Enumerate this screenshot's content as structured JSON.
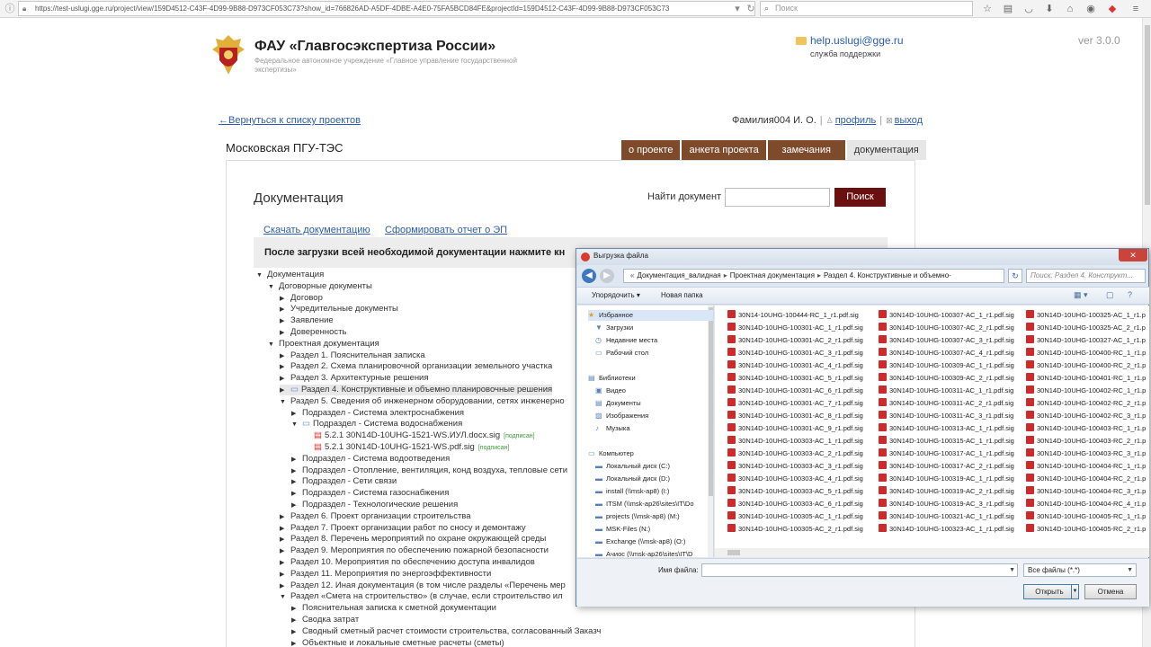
{
  "browser": {
    "url": "https://test-uslugi.gge.ru/project/view/159D4512-C43F-4D99-9B88-D973CF053C73?show_id=766826AD-A5DF-4DBE-A4E0-75FA5BCD84FE&projectId=159D4512-C43F-4D99-9B88-D973CF053C73",
    "search_placeholder": "Поиск"
  },
  "header": {
    "org_title": "ФАУ «Главгосэкспертиза России»",
    "org_subtitle": "Федеральное автономное учреждение «Главное управление государственной экспертизы»",
    "help_email": "help.uslugi@gge.ru",
    "help_caption": "служба поддержки",
    "version": "ver 3.0.0"
  },
  "nav": {
    "back_link": "Вернуться к списку проектов",
    "user_name": "Фамилия004 И. О.",
    "profile": "профиль",
    "logout": "выход"
  },
  "project": {
    "title": "Московская ПГУ-ТЭС",
    "tabs": [
      {
        "label": "о проекте"
      },
      {
        "label": "анкета проекта"
      },
      {
        "label": "замечания"
      },
      {
        "label": "документация"
      }
    ]
  },
  "docs": {
    "heading": "Документация",
    "find_label": "Найти документ",
    "find_button": "Поиск",
    "download_link": "Скачать документацию",
    "report_link": "Сформировать отчет о ЭП",
    "notice": "После загрузки всей необходимой документации нажмите кн"
  },
  "tree": [
    {
      "label": "Документация",
      "tw": "▼"
    },
    {
      "label": "Договорные документы",
      "tw": "▼"
    },
    {
      "label": "Договор",
      "tw": "▶"
    },
    {
      "label": "Учредительные документы",
      "tw": "▶"
    },
    {
      "label": "Заявление",
      "tw": "▶"
    },
    {
      "label": "Доверенность",
      "tw": "▶"
    },
    {
      "label": "Проектная документация",
      "tw": "▼"
    },
    {
      "label": "Раздел 1. Пояснительная записка",
      "tw": "▶"
    },
    {
      "label": "Раздел 2. Схема планировочной организации земельного участка",
      "tw": "▶"
    },
    {
      "label": "Раздел 3. Архитектурные решения",
      "tw": "▶"
    },
    {
      "label": "Раздел 4. Конструктивные и объемно планировочные решения",
      "tw": "▶"
    },
    {
      "label": "Раздел 5. Сведения об инженерном оборудовании, сетях инженерно",
      "tw": "▼"
    },
    {
      "label": "Подраздел - Система электроснабжения",
      "tw": "▶"
    },
    {
      "label": "Подраздел - Система водоснабжения",
      "tw": "▼"
    },
    {
      "label": "5.2.1 30N14D-10UHG-1521-WS.ИУЛ.docx.sig",
      "tw": "",
      "badge": "[подписан]"
    },
    {
      "label": "5.2.1 30N14D-10UHG-1521-WS.pdf.sig",
      "tw": "",
      "badge": "[подписан]"
    },
    {
      "label": "Подраздел - Система водоотведения",
      "tw": "▶"
    },
    {
      "label": "Подраздел - Отопление, вентиляция, конд воздуха, тепловые сети",
      "tw": "▶"
    },
    {
      "label": "Подраздел - Сети связи",
      "tw": "▶"
    },
    {
      "label": "Подраздел - Система газоснабжения",
      "tw": "▶"
    },
    {
      "label": "Подраздел - Технологические решения",
      "tw": "▶"
    },
    {
      "label": "Раздел 6. Проект организации строительства",
      "tw": "▶"
    },
    {
      "label": "Раздел 7. Проект организации работ по сносу и демонтажу",
      "tw": "▶"
    },
    {
      "label": "Раздел 8. Перечень мероприятий по охране окружающей среды",
      "tw": "▶"
    },
    {
      "label": "Раздел 9. Мероприятия по обеспечению пожарной безопасности",
      "tw": "▶"
    },
    {
      "label": "Раздел 10. Мероприятия по обеспечению доступа инвалидов",
      "tw": "▶"
    },
    {
      "label": "Раздел 11. Мероприятия по энергоэффективности",
      "tw": "▶"
    },
    {
      "label": "Раздел 12. Иная документация (в том числе разделы «Перечень мер",
      "tw": "▶"
    },
    {
      "label": "Раздел «Смета на строительство» (в случае, если строительство ил",
      "tw": "▼"
    },
    {
      "label": "Пояснительная записка к сметной документации",
      "tw": "▶"
    },
    {
      "label": "Сводка затрат",
      "tw": "▶"
    },
    {
      "label": "Сводный сметный расчет стоимости строительства, согласованный Заказч",
      "tw": "▶"
    },
    {
      "label": "Объектные и локальные сметные расчеты (сметы)",
      "tw": "▶"
    }
  ],
  "dialog": {
    "title": "Выгрузка файла",
    "breadcrumb": [
      "Документация_валидная",
      "Проектная документация",
      "Раздел 4. Конструктивные и объемно-"
    ],
    "search_placeholder": "Поиск: Раздел 4. Конструкт...",
    "organize": "Упорядочить ▾",
    "new_folder": "Новая папка",
    "nav": [
      {
        "label": "Избранное",
        "icon": "★"
      },
      {
        "label": "Загрузки",
        "icon": "▼"
      },
      {
        "label": "Недавние места",
        "icon": "◷"
      },
      {
        "label": "Рабочий стол",
        "icon": "▭"
      },
      {
        "label": "Библиотеки",
        "icon": "▤"
      },
      {
        "label": "Видео",
        "icon": "▣"
      },
      {
        "label": "Документы",
        "icon": "▤"
      },
      {
        "label": "Изображения",
        "icon": "▨"
      },
      {
        "label": "Музыка",
        "icon": "♪"
      },
      {
        "label": "Компьютер",
        "icon": "▭"
      },
      {
        "label": "Локальный диск (C:)",
        "icon": "▬"
      },
      {
        "label": "Локальный диск (D:)",
        "icon": "▬"
      },
      {
        "label": "install (\\\\msk-ap8) (I:)",
        "icon": "▬"
      },
      {
        "label": "ITSM (\\\\msk-ap26\\sites\\IT\\Do",
        "icon": "▬"
      },
      {
        "label": "projects (\\\\msk-ap8) (M:)",
        "icon": "▬"
      },
      {
        "label": "MSK-Files (N:)",
        "icon": "▬"
      },
      {
        "label": "Exchange (\\\\msk-ap8) (O:)",
        "icon": "▬"
      },
      {
        "label": "Ачиос (\\\\msk-ap26\\sites\\IT\\D",
        "icon": "▬"
      }
    ],
    "files_col1": [
      "30N14-10UHG-100444-RC_1_r1.pdf.sig",
      "30N14D-10UHG-100301-AC_1_r1.pdf.sig",
      "30N14D-10UHG-100301-AC_2_r1.pdf.sig",
      "30N14D-10UHG-100301-AC_3_r1.pdf.sig",
      "30N14D-10UHG-100301-AC_4_r1.pdf.sig",
      "30N14D-10UHG-100301-AC_5_r1.pdf.sig",
      "30N14D-10UHG-100301-AC_6_r1.pdf.sig",
      "30N14D-10UHG-100301-AC_7_r1.pdf.sig",
      "30N14D-10UHG-100301-AC_8_r1.pdf.sig",
      "30N14D-10UHG-100301-AC_9_r1.pdf.sig",
      "30N14D-10UHG-100303-AC_1_r1.pdf.sig",
      "30N14D-10UHG-100303-AC_2_r1.pdf.sig",
      "30N14D-10UHG-100303-AC_3_r1.pdf.sig",
      "30N14D-10UHG-100303-AC_4_r1.pdf.sig",
      "30N14D-10UHG-100303-AC_5_r1.pdf.sig",
      "30N14D-10UHG-100303-AC_6_r1.pdf.sig",
      "30N14D-10UHG-100305-AC_1_r1.pdf.sig",
      "30N14D-10UHG-100305-AC_2_r1.pdf.sig"
    ],
    "files_col2": [
      "30N14D-10UHG-100307-AC_1_r1.pdf.sig",
      "30N14D-10UHG-100307-AC_2_r1.pdf.sig",
      "30N14D-10UHG-100307-AC_3_r1.pdf.sig",
      "30N14D-10UHG-100307-AC_4_r1.pdf.sig",
      "30N14D-10UHG-100309-AC_1_r1.pdf.sig",
      "30N14D-10UHG-100309-AC_2_r1.pdf.sig",
      "30N14D-10UHG-100311-AC_1_r1.pdf.sig",
      "30N14D-10UHG-100311-AC_2_r1.pdf.sig",
      "30N14D-10UHG-100311-AC_3_r1.pdf.sig",
      "30N14D-10UHG-100313-AC_1_r1.pdf.sig",
      "30N14D-10UHG-100315-AC_1_r1.pdf.sig",
      "30N14D-10UHG-100317-AC_1_r1.pdf.sig",
      "30N14D-10UHG-100317-AC_2_r1.pdf.sig",
      "30N14D-10UHG-100319-AC_1_r1.pdf.sig",
      "30N14D-10UHG-100319-AC_2_r1.pdf.sig",
      "30N14D-10UHG-100319-AC_3_r1.pdf.sig",
      "30N14D-10UHG-100321-AC_1_r1.pdf.sig",
      "30N14D-10UHG-100323-AC_1_r1.pdf.sig"
    ],
    "files_col3": [
      "30N14D-10UHG-100325-AC_1_r1.p",
      "30N14D-10UHG-100325-AC_2_r1.p",
      "30N14D-10UHG-100327-AC_1_r1.p",
      "30N14D-10UHG-100400-RC_1_r1.p",
      "30N14D-10UHG-100400-RC_2_r1.p",
      "30N14D-10UHG-100401-RC_1_r1.p",
      "30N14D-10UHG-100402-RC_1_r1.p",
      "30N14D-10UHG-100402-RC_2_r1.p",
      "30N14D-10UHG-100402-RC_3_r1.p",
      "30N14D-10UHG-100403-RC_1_r1.p",
      "30N14D-10UHG-100403-RC_2_r1.p",
      "30N14D-10UHG-100403-RC_3_r1.p",
      "30N14D-10UHG-100404-RC_1_r1.p",
      "30N14D-10UHG-100404-RC_2_r1.p",
      "30N14D-10UHG-100404-RC_3_r1.p",
      "30N14D-10UHG-100404-RC_4_r1.p",
      "30N14D-10UHG-100405-RC_1_r1.p",
      "30N14D-10UHG-100405-RC_2_r1.p"
    ],
    "filename_label": "Имя файла:",
    "filename_value": "",
    "filetype": "Все файлы (*.*)",
    "open_button": "Открыть",
    "cancel_button": "Отмена"
  }
}
